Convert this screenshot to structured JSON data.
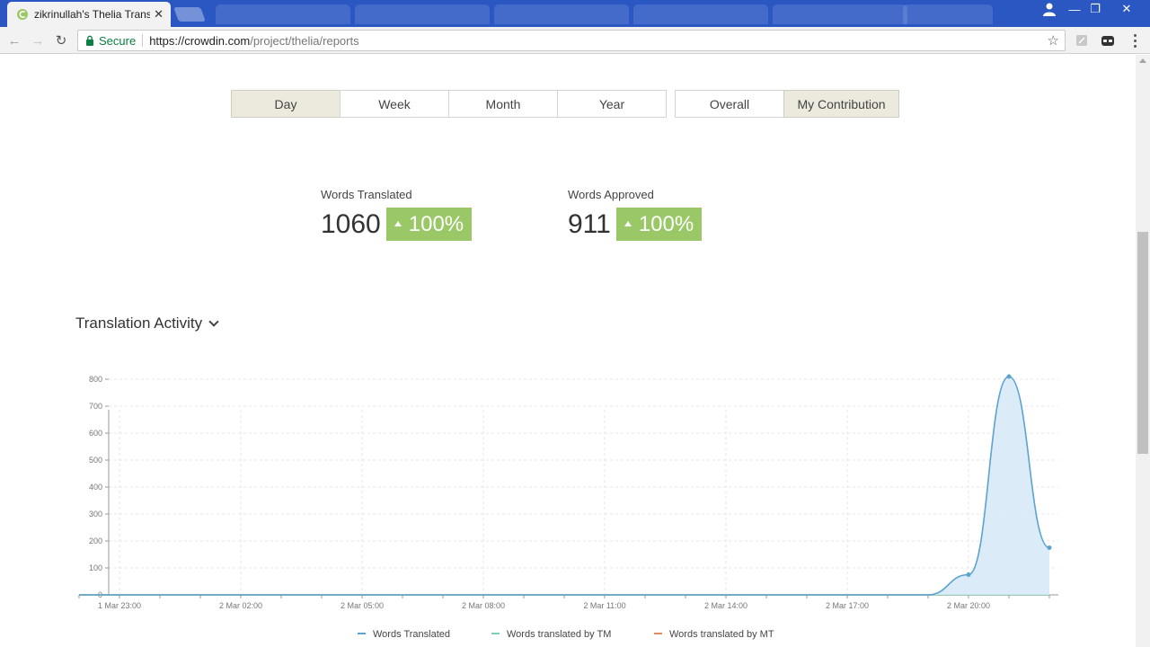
{
  "browser": {
    "active_tab_title": "zikrinullah's Thelia Transl",
    "secure_label": "Secure",
    "url_host": "https://crowdin.com",
    "url_path": "/project/thelia/reports"
  },
  "period_buttons": [
    {
      "label": "Day",
      "active": true
    },
    {
      "label": "Week",
      "active": false
    },
    {
      "label": "Month",
      "active": false
    },
    {
      "label": "Year",
      "active": false
    }
  ],
  "scope_buttons": [
    {
      "label": "Overall",
      "active": false
    },
    {
      "label": "My Contribution",
      "active": true
    }
  ],
  "stats": {
    "words_translated": {
      "label": "Words Translated",
      "value": "1060",
      "change": "100%"
    },
    "words_approved": {
      "label": "Words Approved",
      "value": "911",
      "change": "100%"
    }
  },
  "activity": {
    "title": "Translation Activity"
  },
  "colors": {
    "accent_green": "#9ac866",
    "series_translated": "#5ba3d0",
    "series_tm": "#7fcfb8",
    "series_mt": "#e58a5e",
    "active_button": "#ebeadd"
  },
  "chart_data": {
    "type": "area",
    "x": [
      "1 Mar 22:00",
      "1 Mar 23:00",
      "2 Mar 00:00",
      "2 Mar 01:00",
      "2 Mar 02:00",
      "2 Mar 03:00",
      "2 Mar 04:00",
      "2 Mar 05:00",
      "2 Mar 06:00",
      "2 Mar 07:00",
      "2 Mar 08:00",
      "2 Mar 09:00",
      "2 Mar 10:00",
      "2 Mar 11:00",
      "2 Mar 12:00",
      "2 Mar 13:00",
      "2 Mar 14:00",
      "2 Mar 15:00",
      "2 Mar 16:00",
      "2 Mar 17:00",
      "2 Mar 18:00",
      "2 Mar 19:00",
      "2 Mar 20:00",
      "2 Mar 21:00",
      "2 Mar 22:00"
    ],
    "x_tick_labels": [
      "1 Mar 23:00",
      "2 Mar 02:00",
      "2 Mar 05:00",
      "2 Mar 08:00",
      "2 Mar 11:00",
      "2 Mar 14:00",
      "2 Mar 17:00",
      "2 Mar 20:00"
    ],
    "ylim": [
      0,
      850
    ],
    "y_ticks": [
      0,
      100,
      200,
      300,
      400,
      500,
      600,
      700,
      800
    ],
    "grid": true,
    "legend_position": "bottom",
    "series": [
      {
        "name": "Words Translated",
        "values": [
          0,
          0,
          0,
          0,
          0,
          0,
          0,
          0,
          0,
          0,
          0,
          0,
          0,
          0,
          0,
          0,
          0,
          0,
          0,
          0,
          0,
          0,
          75,
          810,
          175
        ]
      },
      {
        "name": "Words translated by TM",
        "values": [
          0,
          0,
          0,
          0,
          0,
          0,
          0,
          0,
          0,
          0,
          0,
          0,
          0,
          0,
          0,
          0,
          0,
          0,
          0,
          0,
          0,
          0,
          0,
          0,
          0
        ]
      },
      {
        "name": "Words translated by MT",
        "values": [
          0,
          0,
          0,
          0,
          0,
          0,
          0,
          0,
          0,
          0,
          0,
          0,
          0,
          0,
          0,
          0,
          0,
          0,
          0,
          0,
          0,
          0,
          0,
          0,
          0
        ]
      }
    ]
  }
}
